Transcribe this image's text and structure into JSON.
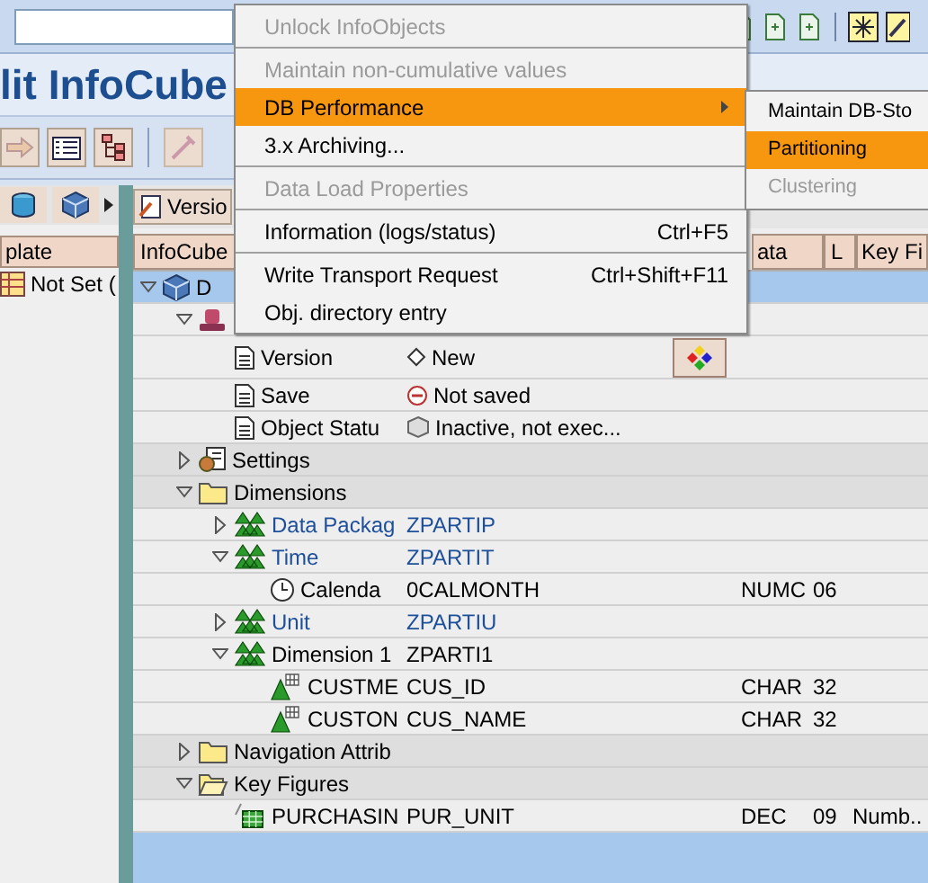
{
  "title": "lit InfoCube",
  "left_panel": {
    "header": "plate",
    "rows": [
      {
        "label": "Not Set ("
      }
    ]
  },
  "right_panel": {
    "toolbar_button": "Versio",
    "columns": [
      {
        "label": "InfoCube",
        "kind": "tree"
      },
      {
        "kind": "hidden"
      },
      {
        "label": "ata",
        "kind": "small"
      },
      {
        "label": "L",
        "kind": "tiny"
      },
      {
        "label": "Key Fi",
        "kind": "small"
      }
    ],
    "tree": [
      {
        "label": "D",
        "kind": "cube",
        "expanded": true,
        "selected": true,
        "children": [
          {
            "kind": "hat",
            "expanded": true,
            "selected": false,
            "children": [
              {
                "label": "Version",
                "kind": "document",
                "value": {
                  "text": "New",
                  "kind": "diamond"
                },
                "action": true,
                "selected": false
              },
              {
                "label": "Save",
                "kind": "document",
                "value": {
                  "text": "Not saved",
                  "kind": "minus"
                },
                "selected": false
              },
              {
                "label": "Object Statu",
                "kind": "document",
                "value": {
                  "text": "Inactive, not exec...",
                  "kind": "cube"
                },
                "selected": false
              }
            ]
          },
          {
            "label": "Settings",
            "kind": "settings",
            "expanded": false,
            "selected": false
          },
          {
            "label": "Dimensions",
            "kind": "folder",
            "expanded": true,
            "selected": false,
            "children": [
              {
                "label": "Data Packag",
                "kind": "dimension",
                "expanded": false,
                "emphasis": true,
                "value": "ZPARTIP",
                "selected": false
              },
              {
                "label": "Time",
                "kind": "dimension",
                "expanded": true,
                "emphasis": true,
                "value": "ZPARTIT",
                "selected": false,
                "children": [
                  {
                    "label": "Calenda",
                    "kind": "clock",
                    "value": "0CALMONTH",
                    "type": "NUMC",
                    "length": "06",
                    "selected": false
                  }
                ]
              },
              {
                "label": "Unit",
                "kind": "dimension",
                "expanded": false,
                "emphasis": true,
                "value": "ZPARTIU",
                "selected": false
              },
              {
                "label": "Dimension 1",
                "kind": "dimension",
                "expanded": true,
                "emphasis": false,
                "value": "ZPARTI1",
                "selected": false,
                "children": [
                  {
                    "label": "CUSTME",
                    "kind": "characteristic",
                    "value": "CUS_ID",
                    "type": "CHAR",
                    "length": "32",
                    "selected": false
                  },
                  {
                    "label": "CUSTON",
                    "kind": "characteristic",
                    "value": "CUS_NAME",
                    "type": "CHAR",
                    "length": "32",
                    "selected": false
                  }
                ]
              }
            ]
          },
          {
            "label": "Navigation Attrib",
            "kind": "folder",
            "expanded": false,
            "selected": false
          },
          {
            "label": "Key Figures",
            "kind": "folder-open",
            "expanded": true,
            "selected": false,
            "children": [
              {
                "label": "PURCHASIN",
                "kind": "key-figure",
                "value": "PUR_UNIT",
                "type": "DEC",
                "length": "09",
                "description": "Numb..",
                "selected": false
              }
            ]
          }
        ]
      }
    ]
  },
  "menu": {
    "items": [
      {
        "kind": "item",
        "label": "Unlock InfoObjects",
        "disabled": true,
        "highlighted": false
      },
      {
        "kind": "separator"
      },
      {
        "kind": "item",
        "label": "Maintain non-cumulative values",
        "disabled": true,
        "highlighted": false
      },
      {
        "kind": "submenu",
        "label": "DB Performance",
        "disabled": false,
        "highlighted": true
      },
      {
        "kind": "item",
        "label": "3.x Archiving...",
        "disabled": false,
        "highlighted": false
      },
      {
        "kind": "separator"
      },
      {
        "kind": "item",
        "label": "Data Load Properties",
        "disabled": true,
        "highlighted": false
      },
      {
        "kind": "separator"
      },
      {
        "kind": "item",
        "label": "Information (logs/status)",
        "shortcut": "Ctrl+F5",
        "disabled": false,
        "highlighted": false
      },
      {
        "kind": "separator"
      },
      {
        "kind": "item",
        "label": "Write Transport Request",
        "shortcut": "Ctrl+Shift+F11",
        "disabled": false,
        "highlighted": false
      },
      {
        "kind": "item",
        "label": "Obj. directory entry",
        "disabled": false,
        "highlighted": false
      }
    ]
  },
  "submenu": {
    "items": [
      {
        "label": "Maintain DB-Sto",
        "disabled": false,
        "highlighted": false
      },
      {
        "label": "Partitioning",
        "disabled": false,
        "highlighted": true
      },
      {
        "label": "Clustering",
        "disabled": true,
        "highlighted": false
      }
    ]
  }
}
